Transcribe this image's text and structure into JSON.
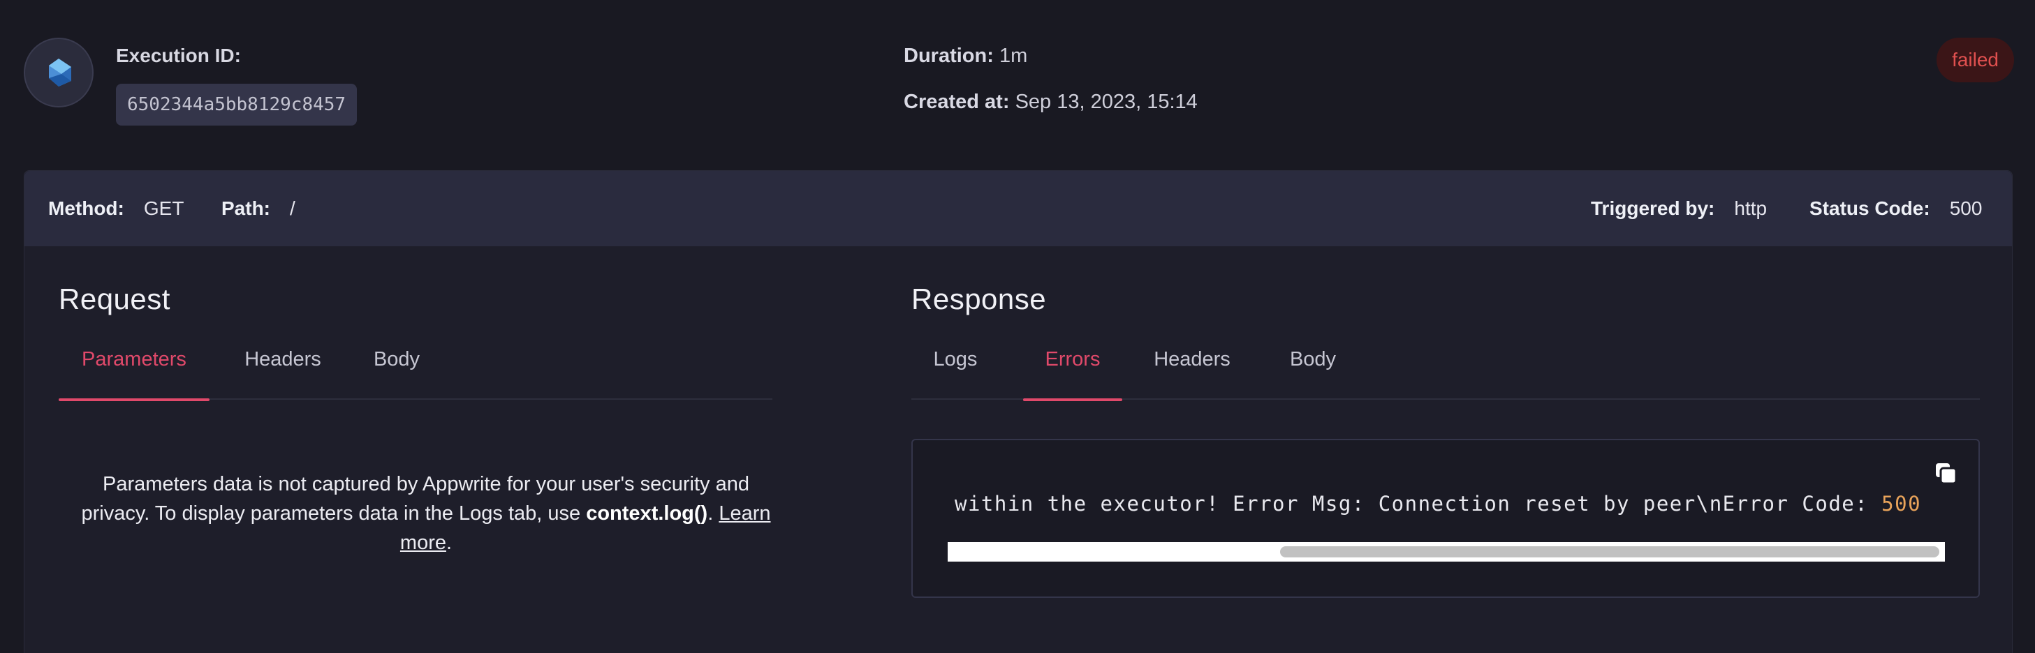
{
  "execution": {
    "id_label": "Execution ID:",
    "id_value": "6502344a5bb8129c8457",
    "duration_label": "Duration:",
    "duration_value": "1m",
    "created_label": "Created at:",
    "created_value": "Sep 13, 2023, 15:14",
    "status": "failed",
    "avatar_icon": "dart-logo-icon"
  },
  "bar": {
    "method_label": "Method:",
    "method_value": "GET",
    "path_label": "Path:",
    "path_value": "/",
    "triggered_label": "Triggered by:",
    "triggered_value": "http",
    "status_label": "Status Code:",
    "status_value": "500"
  },
  "request": {
    "title": "Request",
    "tabs": [
      {
        "label": "Parameters",
        "active": true
      },
      {
        "label": "Headers",
        "active": false
      },
      {
        "label": "Body",
        "active": false
      }
    ],
    "message_text": "Parameters data is not captured by Appwrite for your user's security and privacy. To display parameters data in the Logs tab, use",
    "message_code": "context.log()",
    "message_sep": ". ",
    "message_link": "Learn more",
    "message_end": "."
  },
  "response": {
    "title": "Response",
    "tabs": [
      {
        "label": "Logs",
        "active": false
      },
      {
        "label": "Errors",
        "active": true
      },
      {
        "label": "Headers",
        "active": false
      },
      {
        "label": "Body",
        "active": false
      }
    ],
    "error_text": "within the executor! Error Msg: Connection reset by peer\\nError Code: ",
    "error_code": "500",
    "copy_icon": "copy-icon"
  },
  "colors": {
    "accent": "#e0496a",
    "status_failed_text": "#e0504f",
    "status_failed_bg": "#3b1517",
    "code_number": "#e8a35a"
  }
}
